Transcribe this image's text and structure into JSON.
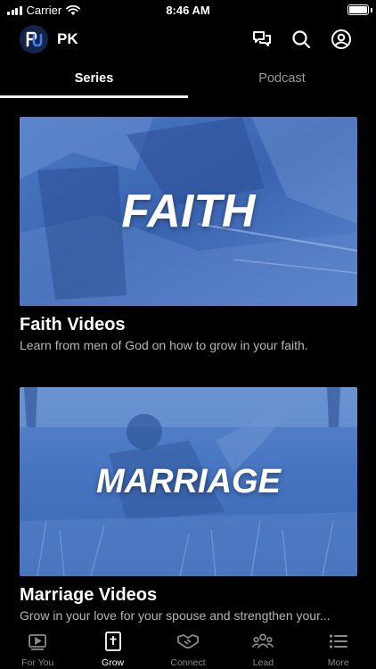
{
  "status_bar": {
    "carrier": "Carrier",
    "time": "8:46 AM",
    "battery_level": 1.0
  },
  "header": {
    "logo_text": "PK",
    "title": "PK",
    "icons": [
      "chat-icon",
      "search-icon",
      "profile-icon"
    ]
  },
  "tabs": [
    {
      "label": "Series",
      "active": true
    },
    {
      "label": "Podcast",
      "active": false
    }
  ],
  "cards": [
    {
      "overlay_text": "FAITH",
      "title": "Faith Videos",
      "description": "Learn from men of God on how to grow in your faith."
    },
    {
      "overlay_text": "MARRIAGE",
      "title": "Marriage Videos",
      "description": "Grow in your love for your spouse and strengthen your..."
    }
  ],
  "bottom_nav": [
    {
      "label": "For You",
      "icon": "play-screen-icon",
      "active": false
    },
    {
      "label": "Grow",
      "icon": "bible-icon",
      "active": true
    },
    {
      "label": "Connect",
      "icon": "handshake-icon",
      "active": false
    },
    {
      "label": "Lead",
      "icon": "group-icon",
      "active": false
    },
    {
      "label": "More",
      "icon": "list-icon",
      "active": false
    }
  ],
  "colors": {
    "background": "#000000",
    "card_tint": "#3f6fbf",
    "logo_bg": "#13234a",
    "inactive": "#8a8a8a"
  }
}
